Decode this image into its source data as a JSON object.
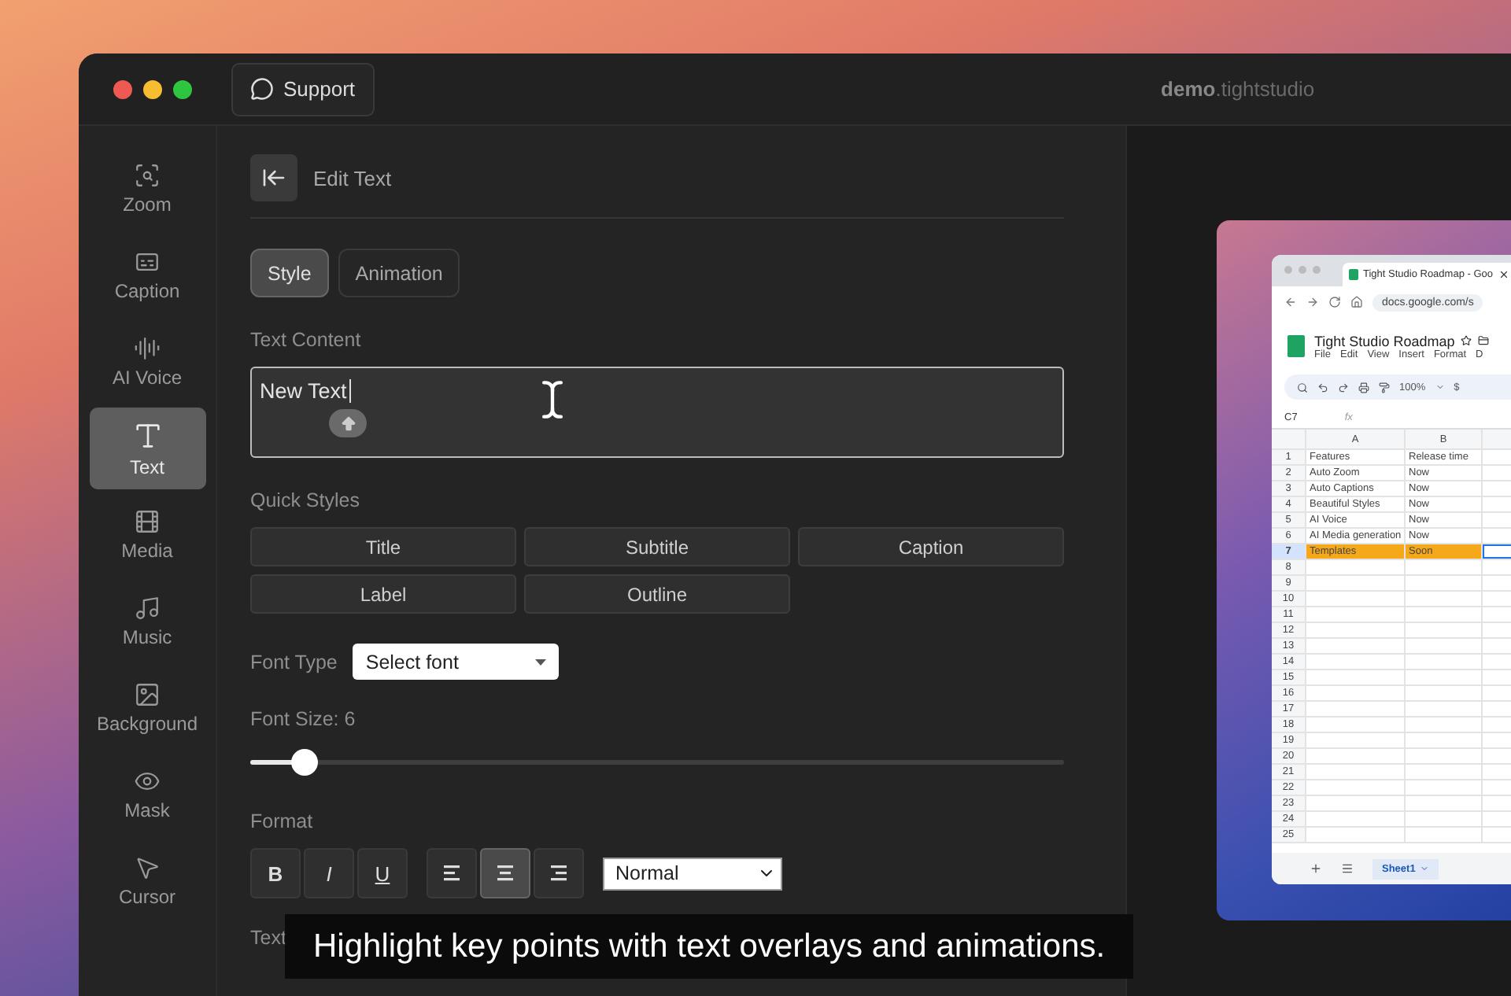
{
  "window": {
    "support_button": "Support",
    "title": "**demo**.tightstudio"
  },
  "sidebar": {
    "items": [
      {
        "label": "Zoom",
        "selected": false
      },
      {
        "label": "Caption",
        "selected": false
      },
      {
        "label": "AI Voice",
        "selected": false
      },
      {
        "label": "Text",
        "selected": true
      },
      {
        "label": "Media",
        "selected": false
      },
      {
        "label": "Music",
        "selected": false
      },
      {
        "label": "Background",
        "selected": false
      },
      {
        "label": "Mask",
        "selected": false
      },
      {
        "label": "Cursor",
        "selected": false
      }
    ]
  },
  "panel": {
    "title": "Edit Text",
    "tabs": [
      {
        "label": "Style",
        "selected": true
      },
      {
        "label": "Animation",
        "selected": false
      }
    ],
    "text_content": {
      "label": "Text Content",
      "value": "New Text"
    },
    "quick_styles": {
      "label": "Quick Styles",
      "buttons": [
        "Title",
        "Subtitle",
        "Caption",
        "Label",
        "Outline"
      ]
    },
    "font_type": {
      "label": "Font Type",
      "value": "Select font"
    },
    "font_size": {
      "label": "Font Size: 6",
      "level": 0.066
    },
    "format": {
      "label": "Format",
      "style_buttons": [
        {
          "label": "B",
          "kind": "bold"
        },
        {
          "label": "I",
          "kind": "italic"
        },
        {
          "label": "U",
          "kind": "underline"
        }
      ],
      "align_buttons": [
        {
          "kind": "left",
          "selected": false
        },
        {
          "kind": "center",
          "selected": true
        },
        {
          "kind": "right",
          "selected": false
        }
      ],
      "block_select": "Normal"
    },
    "text_color_label": "Text"
  },
  "preview": {
    "tab_title": "Tight Studio Roadmap - Goo",
    "url": "docs.google.com/s",
    "doc_title": "Tight Studio Roadmap",
    "menu": [
      "File",
      "Edit",
      "View",
      "Insert",
      "Format",
      "D"
    ],
    "zoom": "100%",
    "currency": "$",
    "cell_ref": "C7",
    "formula_label": "fx",
    "columns": [
      "A",
      "B"
    ],
    "rows": [
      {
        "number": "1",
        "cells": [
          "Features",
          "Release time"
        ],
        "highlighted": false
      },
      {
        "number": "2",
        "cells": [
          "Auto Zoom",
          "Now"
        ],
        "highlighted": false
      },
      {
        "number": "3",
        "cells": [
          "Auto Captions",
          "Now"
        ],
        "highlighted": false
      },
      {
        "number": "4",
        "cells": [
          "Beautiful Styles",
          "Now"
        ],
        "highlighted": false
      },
      {
        "number": "5",
        "cells": [
          "AI Voice",
          "Now"
        ],
        "highlighted": false
      },
      {
        "number": "6",
        "cells": [
          "AI Media generation",
          "Now"
        ],
        "highlighted": false
      },
      {
        "number": "7",
        "cells": [
          "Templates",
          "Soon"
        ],
        "highlighted": true
      },
      {
        "number": "8",
        "highlighted": false
      },
      {
        "number": "9",
        "highlighted": false
      },
      {
        "number": "10",
        "highlighted": false
      },
      {
        "number": "11",
        "highlighted": false
      },
      {
        "number": "12",
        "highlighted": false
      },
      {
        "number": "13",
        "highlighted": false
      },
      {
        "number": "14",
        "highlighted": false
      },
      {
        "number": "15",
        "highlighted": false
      },
      {
        "number": "16",
        "highlighted": false
      },
      {
        "number": "17",
        "highlighted": false
      },
      {
        "number": "18",
        "highlighted": false
      },
      {
        "number": "19",
        "highlighted": false
      },
      {
        "number": "20",
        "highlighted": false
      },
      {
        "number": "21",
        "highlighted": false
      },
      {
        "number": "22",
        "highlighted": false
      },
      {
        "number": "23",
        "highlighted": false
      },
      {
        "number": "24",
        "highlighted": false
      },
      {
        "number": "25",
        "highlighted": false
      }
    ],
    "sheet_tab": "Sheet1"
  },
  "subtitle": "Highlight key points with text overlays and animations."
}
